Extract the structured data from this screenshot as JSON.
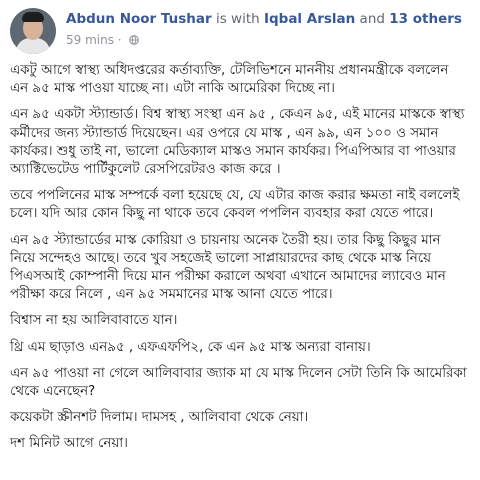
{
  "post": {
    "author": "Abdun Noor Tushar",
    "tag_connector": "is with",
    "tagged_person": "Iqbal Arslan",
    "tag_and": "and",
    "others_link": "13 others",
    "timestamp": "59 mins",
    "separator": "·",
    "privacy_icon": "globe-icon",
    "paragraphs": [
      "একটু আগে স্বাস্থ্য অধিদপ্তরের কর্তাব্যক্তি, টেলিভিশনে মাননীয় প্রধানমন্ত্রীকে বললেন এন ৯৫ মাস্ক পাওয়া যাচ্ছে না। এটা নাকি আমেরিকা দিচ্ছে না।",
      "এন ৯৫ একটা স্ট্যান্ডার্ড। বিশ্ব স্বাস্থ্য সংস্থা এন ৯৫ , কেএন ৯৫, এই মানের মাস্ককে স্বাস্থ্য কর্মীদের জন্য স্ট্যান্ডার্ড দিয়েছেন। এর ওপরে যে মাস্ক , এন ৯৯, এন ১০০ ও সমান কার্যকর। শুধু তাই না, ভালো মেডিক্যাল মাস্কও সমান কার্যকর। পিএপিআর বা পাওয়ার অ্যাক্টিভেটেড পার্টিকুলেট রেসপিরেটরও কাজ করে ।",
      "তবে পপলিনের মাস্ক সম্পর্কে বলা হয়েছে যে, যে এটার কাজ করার ক্ষমতা নাই বললেই চলে। যদি আর কোন কিছু না থাকে তবে কেবল পপলিন ব্যবহার করা যেতে পারে।",
      "এন ৯৫ স্ট্যান্ডার্ডের মাস্ক কোরিয়া ও চায়নায় অনেক তৈরী হয়। তার কিছু কিছুর মান নিয়ে সন্দেহও আছে। তবে খুব সহজেই ভালো সাপ্লায়ারদের কাছ থেকে মাস্ক নিয়ে পিএসআই কোম্পানী দিয়ে মান পরীক্ষা করালে অথবা এখানে আমাদের ল্যাবেও মান পরীক্ষা করে নিলে , এন ৯৫ সমমানের মাস্ক আনা যেতে পারে।",
      "বিশ্বাস না হয় আলিবাবাতে যান।",
      "থ্রি এম ছাড়াও এন৯৫ , এফএফপি২, কে এন ৯৫ মাস্ক অন্যরা বানায়।",
      "এন ৯৫ পাওয়া না গেলে আলিবাবার জ্যাক মা যে মাস্ক দিলেন সেটা তিনি কি আমেরিকা থেকে এনেছেন?",
      "কয়েকটা স্ক্রীনশট দিলাম। দামসহ , আলিবাবা থেকে নেয়া।",
      "দশ মিনিট আগে নেয়া।"
    ]
  }
}
